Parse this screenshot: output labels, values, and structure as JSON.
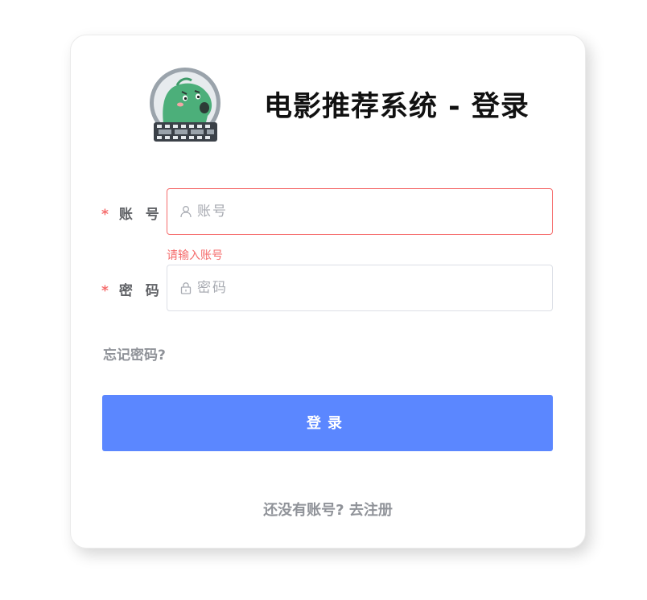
{
  "header": {
    "title": "电影推荐系统 - 登录",
    "logo_icon": "dinosaur-film-logo-icon"
  },
  "form": {
    "account": {
      "label": "账 号",
      "required_mark": "*",
      "placeholder": "账号",
      "value": "",
      "icon": "user-icon",
      "error": "请输入账号"
    },
    "password": {
      "label": "密 码",
      "required_mark": "*",
      "placeholder": "密码",
      "value": "",
      "icon": "lock-icon"
    },
    "forgot_label": "忘记密码?",
    "login_label": "登录"
  },
  "footer": {
    "register_label": "还没有账号? 去注册"
  },
  "colors": {
    "primary": "#5b87ff",
    "error": "#f56c6c",
    "muted": "#909399",
    "label": "#606266"
  }
}
